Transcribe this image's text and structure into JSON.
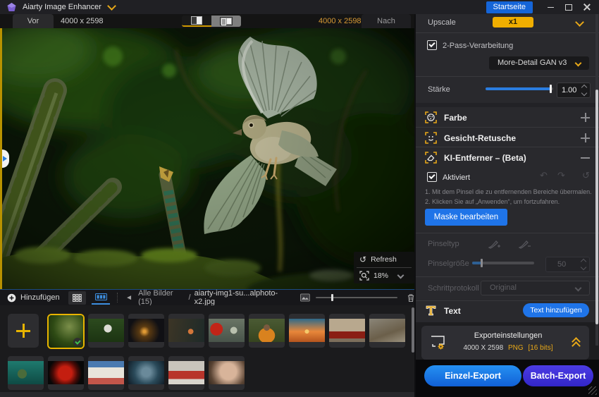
{
  "titlebar": {
    "app_name": "Aiarty Image Enhancer",
    "home_button": "Startseite"
  },
  "toolbar": {
    "before_tab": "Vor",
    "before_size": "4000 x 2598",
    "after_size": "4000 x 2598",
    "after_tab": "Nach"
  },
  "overlay": {
    "refresh_label": "Refresh",
    "zoom_value": "18%"
  },
  "icons": {
    "refresh": "↺",
    "undo": "↶",
    "redo": "↷",
    "reset": "↺",
    "back": "◄"
  },
  "filmstrip": {
    "add_label": "Hinzufügen",
    "breadcrumb": "Alle Bilder (15)",
    "slash": "/",
    "filename": "aiarty-img1-su...alphoto-x2.jpg",
    "thumbnails": [
      "bird-moss-selected",
      "heron",
      "night-city",
      "autumn-lake-house",
      "hibiscus-hummingbird",
      "child-orange-jacket",
      "sunset-grass",
      "red-classic-car",
      "village-street",
      "underwater-turtle",
      "red-betta-fish",
      "white-building-flowers",
      "dog-closeup",
      "red-station-snow",
      "woman-portrait"
    ]
  },
  "panel": {
    "upscale": {
      "label": "Upscale",
      "value": "x1"
    },
    "two_pass": {
      "label": "2-Pass-Verarbeitung",
      "model": "More-Detail GAN  v3"
    },
    "strength": {
      "label": "Stärke",
      "value": "1.00"
    },
    "sections": {
      "color": "Farbe",
      "face": "Gesicht-Retusche",
      "remover": "KI-Entferner – (Beta)"
    },
    "remover": {
      "enabled_label": "Aktiviert",
      "step1": "1. Mit dem Pinsel die zu entfernenden Bereiche übermalen.",
      "step2": "2. Klicken Sie auf „Anwenden“, um fortzufahren.",
      "edit_mask": "Maske bearbeiten",
      "brush_type_label": "Pinseltyp",
      "brush_size_label": "Pinselgröße",
      "brush_size_value": "50",
      "history_label": "Schrittprotokoll",
      "history_value": "Original"
    },
    "text_section": {
      "label": "Text",
      "add_button": "Text hinzufügen"
    },
    "export": {
      "title": "Exporteinstellungen",
      "size": "4000 X 2598",
      "format": "PNG",
      "bits": "[16 bits]",
      "single": "Einzel-Export",
      "batch": "Batch-Export"
    }
  },
  "colors": {
    "accent_yellow": "#f0ae00",
    "accent_blue": "#1f74e8",
    "single_export_blue": "#1a78e4",
    "batch_export_indigo": "#4334d8",
    "slider_blue": "#2a7de0"
  }
}
